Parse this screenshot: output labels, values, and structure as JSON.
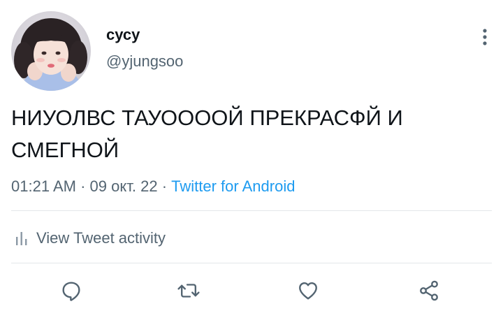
{
  "user": {
    "display_name": "сусу",
    "handle": "@yjungsoo"
  },
  "tweet": {
    "text": "НИУОЛВС ТАУООООЙ ПРЕКРАСФЙ И СМЕГНОЙ",
    "time": "01:21 AM",
    "separator": "·",
    "date": "09 окт. 22",
    "source": "Twitter for Android"
  },
  "activity": {
    "label": "View Tweet activity"
  },
  "icons": {
    "more": "more-vertical-icon",
    "analytics": "analytics-bars-icon",
    "reply": "reply-icon",
    "retweet": "retweet-icon",
    "like": "heart-icon",
    "share": "share-icon"
  },
  "colors": {
    "text": "#0f1419",
    "secondary": "#536471",
    "link": "#1d9bf0",
    "divider": "#e3e6e9"
  }
}
